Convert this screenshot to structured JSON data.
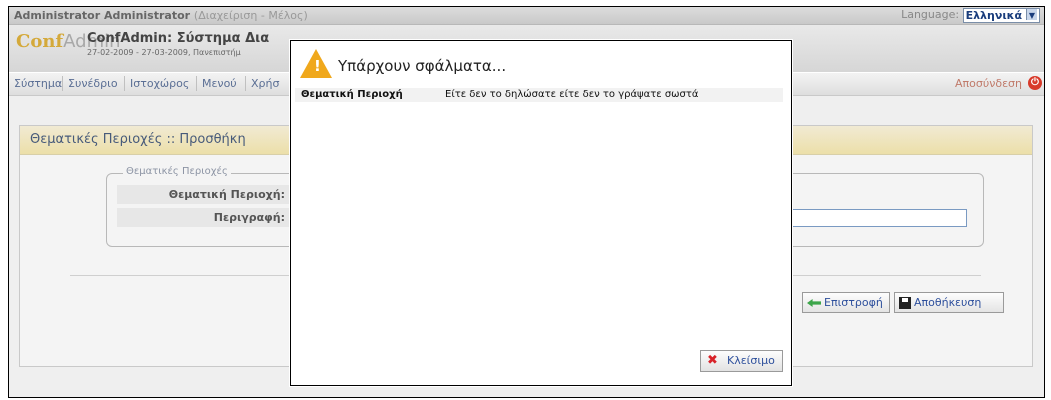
{
  "topbar": {
    "user": "Administrator Administrator",
    "role": "(Διαχείριση - Μέλος)",
    "language_label": "Language:",
    "language_value": "Ελληνικά"
  },
  "header": {
    "logo_conf": "Conf",
    "logo_admin": "Admin",
    "title": "ConfAdmin: Σύστημα Δια",
    "subtitle": "27-02-2009 - 27-03-2009, Πανεπιστήμ"
  },
  "menu": {
    "items": [
      "Σύστημα",
      "Συνέδριο",
      "Ιστοχώρος",
      "Μενού",
      "Χρήσ"
    ],
    "logout": "Αποσύνδεση"
  },
  "panel": {
    "title": "Θεματικές Περιοχές :: Προσθήκη",
    "legend": "Θεματικές Περιοχές",
    "field1_label": "Θεματική Περιοχή:",
    "field2_label": "Περιγραφή:",
    "field1_value": "",
    "field2_value": "",
    "back_label": "Επιστροφή",
    "save_label": "Αποθήκευση"
  },
  "dialog": {
    "title": "Υπάρχουν σφάλματα...",
    "errors": [
      {
        "field": "Θεματική Περιοχή",
        "message": "Είτε δεν το δηλώσατε είτε δεν το γράψατε σωστά"
      }
    ],
    "close_label": "Κλείσιμο"
  },
  "colors": {
    "accent": "#2d4f9c",
    "warning": "#f0a81c",
    "panel_header": "#ecdfa9"
  }
}
